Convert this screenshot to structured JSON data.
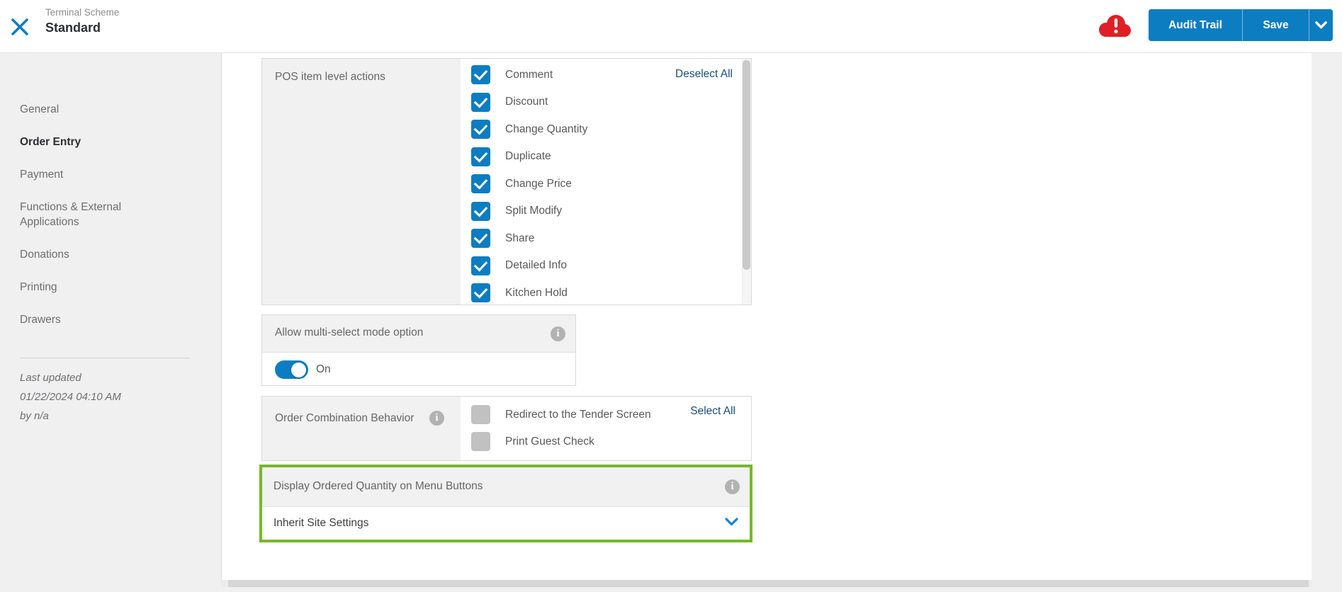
{
  "header": {
    "scheme_label": "Terminal Scheme",
    "scheme_name": "Standard",
    "audit_trail_label": "Audit Trail",
    "save_label": "Save"
  },
  "sidebar": {
    "items": [
      {
        "label": "General",
        "active": false
      },
      {
        "label": "Order Entry",
        "active": true
      },
      {
        "label": "Payment",
        "active": false
      },
      {
        "label": "Functions & External Applications",
        "active": false
      },
      {
        "label": "Donations",
        "active": false
      },
      {
        "label": "Printing",
        "active": false
      },
      {
        "label": "Drawers",
        "active": false
      }
    ],
    "last_updated_label": "Last updated",
    "last_updated_date": "01/22/2024 04:10 AM",
    "last_updated_by": "by n/a"
  },
  "main": {
    "pos_item_actions": {
      "label": "POS item level actions",
      "deselect_all_label": "Deselect All",
      "options": [
        {
          "label": "Comment",
          "checked": true
        },
        {
          "label": "Discount",
          "checked": true
        },
        {
          "label": "Change Quantity",
          "checked": true
        },
        {
          "label": "Duplicate",
          "checked": true
        },
        {
          "label": "Change Price",
          "checked": true
        },
        {
          "label": "Split Modify",
          "checked": true
        },
        {
          "label": "Share",
          "checked": true
        },
        {
          "label": "Detailed Info",
          "checked": true
        },
        {
          "label": "Kitchen Hold",
          "checked": true
        }
      ]
    },
    "multi_select": {
      "label": "Allow multi-select mode option",
      "state": "On",
      "toggle_on": true
    },
    "order_combination": {
      "label": "Order Combination Behavior",
      "select_all_label": "Select All",
      "options": [
        {
          "label": "Redirect to the Tender Screen",
          "checked": false
        },
        {
          "label": "Print Guest Check",
          "checked": false
        }
      ]
    },
    "display_ordered_quantity": {
      "label": "Display Ordered Quantity on Menu Buttons",
      "value": "Inherit Site Settings",
      "highlighted": true
    }
  },
  "icons": {
    "close": "x-cross",
    "alert": "red-cloud-exclamation",
    "info": "i",
    "chevron_down": "v"
  },
  "colors": {
    "accent_blue": "#0d7dc1",
    "link_navy": "#1b4e74",
    "highlight_green": "#76b82a",
    "alert_red": "#e01e25"
  }
}
